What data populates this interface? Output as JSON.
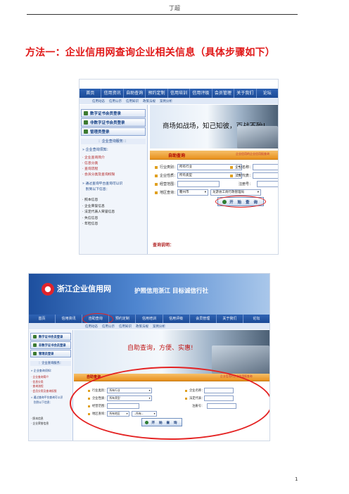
{
  "header": {
    "author": "丁超"
  },
  "heading": "方法一：企业信用网查询企业相关信息（具体步骤如下）",
  "page_number": "1",
  "shot1": {
    "nav": [
      "首页",
      "信用资讯",
      "自助查询",
      "预约定制",
      "信用培训",
      "信用评级",
      "会员管理",
      "关于我们",
      "论坛"
    ],
    "subnav": [
      "信用动态",
      "信用公示",
      "信用知识",
      "政策法规",
      "案例分析"
    ],
    "sidebar": {
      "login_buttons": [
        "数字证书会员登录",
        "非数字证书会员登录",
        "管理员登录"
      ],
      "services_heading": "：企业查询服务：：",
      "notice_title": "» 企业查询须知：",
      "links": [
        "· 企业查询简介",
        "· 信息分类",
        "· 查询流程",
        "· 会员分类及查询权限"
      ],
      "authorized_title": "» 通过查询平台查询可以识",
      "authorized_sub": "　别到以下信息：",
      "info": [
        "· 照本信息",
        "· 企业荣誉信息",
        "· 法定代表人荣誉信息",
        "· 失信信息",
        "· 年检信息"
      ]
    },
    "banner_text": "商场如战场，知己知彼，百战不殆!",
    "form": {
      "tab": "自助查询",
      "note": "企业信用的企业信用报查询",
      "industry_label": "行业类别：",
      "industry_value": "所有行业",
      "name_label": "企业名称：",
      "type_label": "企业性质：",
      "type_value": "所有类型",
      "legal_label": "法定代表：",
      "scope_label": "经营范围：",
      "reg_label": "注册号：",
      "region_label": "地区查询：",
      "city_value": "衢州市",
      "bureau_value": "龙游县工商行政管理局",
      "query_button": "开 始 查 询"
    },
    "footer_label": "查询说明："
  },
  "shot2": {
    "site_name": "浙江企业信用网",
    "slogan": "护照信用浙江 目标诚信行社",
    "nav": [
      "首页",
      "信用资讯",
      "自助查询",
      "预约定制",
      "信用培训",
      "信用评级",
      "会员管理",
      "关于我们",
      "论坛"
    ],
    "subnav": [
      "信用动态",
      "信用公示",
      "信用知识",
      "政策法规",
      "案例分析"
    ],
    "sidebar": {
      "login_buttons": [
        "数字证书会员登录",
        "非数字证书会员登录",
        "管理员登录"
      ],
      "services_heading": "：企业查询服务：",
      "notice_title": "» 企业查询须知：",
      "links": [
        "· 企业查询简介",
        "· 信息分类",
        "· 查询流程",
        "· 会员分类及查询权限"
      ],
      "authorized_title": "» 通过查询平台查询可以识",
      "authorized_sub": "　别到以下信息：",
      "info": [
        "· 照本信息",
        "· 企业荣誉信息"
      ]
    },
    "banner_text": "自助查询，方便、实惠!",
    "form": {
      "tab": "自助查询",
      "note": "企业信用的企业信用报查询",
      "industry_label": "行业类别：",
      "industry_value": "所有行业",
      "name_label": "企业名称：",
      "type_label": "企业性质：",
      "type_value": "所有类型",
      "legal_label": "法定代表：",
      "scope_label": "经营范围：",
      "reg_label": "注册号：",
      "region_label": "地区查询：",
      "city_value": "所有地区",
      "bureau_value": "--所有--",
      "query_button": "开 始 查 询"
    }
  }
}
